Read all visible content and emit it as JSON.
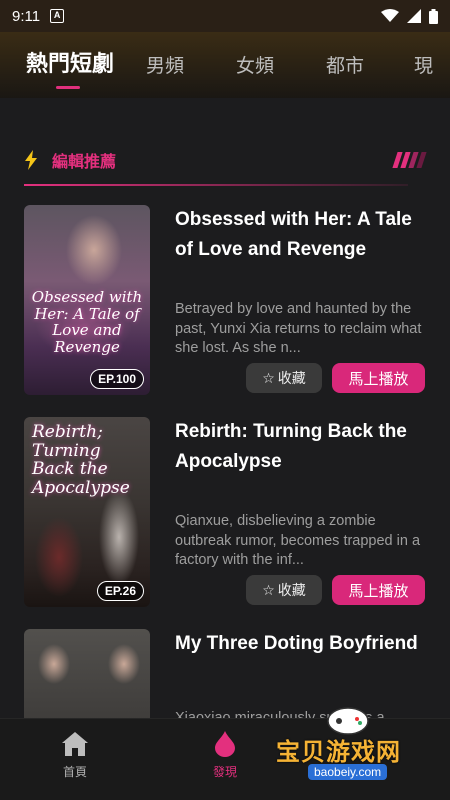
{
  "status_bar": {
    "time": "9:11",
    "notification_glyph": "A"
  },
  "tabs": [
    {
      "label": "熱門短劇",
      "active": true
    },
    {
      "label": "男頻"
    },
    {
      "label": "女頻"
    },
    {
      "label": "都市"
    },
    {
      "label": "現"
    }
  ],
  "section": {
    "title": "編輯推薦",
    "icon": "lightning-icon"
  },
  "items": [
    {
      "title": "Obsessed with Her: A Tale of Love and Revenge",
      "description": "Betrayed by love and haunted by the past, Yunxi Xia returns to reclaim what she lost. As she n...",
      "episode": "EP.100",
      "poster_text": "Obsessed with Her: A Tale of Love and Revenge",
      "fav_label": "收藏",
      "play_label": "馬上播放"
    },
    {
      "title": "Rebirth: Turning Back the Apocalypse",
      "description": "Qianxue, disbelieving a zombie outbreak rumor, becomes trapped in a factory with the inf...",
      "episode": "EP.26",
      "poster_text": "Rebirth; Turning Back the Apocalypse",
      "fav_label": "收藏",
      "play_label": "馬上播放"
    },
    {
      "title": "My Three Doting Boyfriend",
      "description": "Xiaoxiao miraculously survives a..."
    }
  ],
  "bottom_nav": [
    {
      "label": "首頁",
      "icon": "home-icon"
    },
    {
      "label": "發現",
      "icon": "flame-drop-icon",
      "active": true
    }
  ],
  "watermark": {
    "text": "宝贝游戏网",
    "url": "baobeiy.com"
  },
  "colors": {
    "accent": "#e3307e",
    "background": "#1c1c1e",
    "play_button": "#d9287a"
  }
}
